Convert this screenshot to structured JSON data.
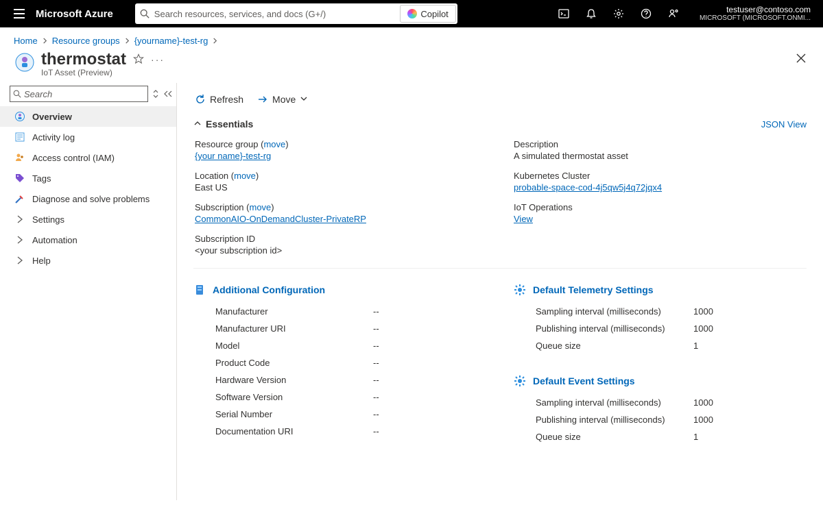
{
  "topbar": {
    "brand": "Microsoft Azure",
    "search_placeholder": "Search resources, services, and docs (G+/)",
    "copilot_label": "Copilot",
    "account_email": "testuser@contoso.com",
    "account_tenant": "MICROSOFT (MICROSOFT.ONMI..."
  },
  "breadcrumbs": {
    "items": [
      "Home",
      "Resource groups",
      "{yourname}-test-rg"
    ]
  },
  "resource": {
    "title": "thermostat",
    "subtitle": "IoT Asset (Preview)"
  },
  "sidebar": {
    "search_placeholder": "Search",
    "items": [
      {
        "label": "Overview"
      },
      {
        "label": "Activity log"
      },
      {
        "label": "Access control (IAM)"
      },
      {
        "label": "Tags"
      },
      {
        "label": "Diagnose and solve problems"
      },
      {
        "label": "Settings"
      },
      {
        "label": "Automation"
      },
      {
        "label": "Help"
      }
    ]
  },
  "commands": {
    "refresh": "Refresh",
    "move": "Move"
  },
  "essentials": {
    "header": "Essentials",
    "json_view": "JSON View",
    "left": {
      "resource_group_label": "Resource group",
      "move1": "move",
      "resource_group_value": "{your name}-test-rg",
      "location_label": "Location",
      "move2": "move",
      "location_value": "East US",
      "subscription_label": "Subscription",
      "move3": "move",
      "subscription_value": "CommonAIO-OnDemandCluster-PrivateRP",
      "subscription_id_label": "Subscription ID",
      "subscription_id_value": "<your subscription id>"
    },
    "right": {
      "description_label": "Description",
      "description_value": "A simulated thermostat asset",
      "k8s_label": "Kubernetes Cluster",
      "k8s_value": "probable-space-cod-4j5qw5j4q72jqx4",
      "iot_ops_label": "IoT Operations",
      "iot_ops_value": "View"
    }
  },
  "additional_config": {
    "header": "Additional Configuration",
    "rows": [
      {
        "k": "Manufacturer",
        "v": "--"
      },
      {
        "k": "Manufacturer URI",
        "v": "--"
      },
      {
        "k": "Model",
        "v": "--"
      },
      {
        "k": "Product Code",
        "v": "--"
      },
      {
        "k": "Hardware Version",
        "v": "--"
      },
      {
        "k": "Software Version",
        "v": "--"
      },
      {
        "k": "Serial Number",
        "v": "--"
      },
      {
        "k": "Documentation URI",
        "v": "--"
      }
    ]
  },
  "telemetry": {
    "header": "Default Telemetry Settings",
    "rows": [
      {
        "k": "Sampling interval (milliseconds)",
        "v": "1000"
      },
      {
        "k": "Publishing interval (milliseconds)",
        "v": "1000"
      },
      {
        "k": "Queue size",
        "v": "1"
      }
    ]
  },
  "events": {
    "header": "Default Event Settings",
    "rows": [
      {
        "k": "Sampling interval (milliseconds)",
        "v": "1000"
      },
      {
        "k": "Publishing interval (milliseconds)",
        "v": "1000"
      },
      {
        "k": "Queue size",
        "v": "1"
      }
    ]
  }
}
